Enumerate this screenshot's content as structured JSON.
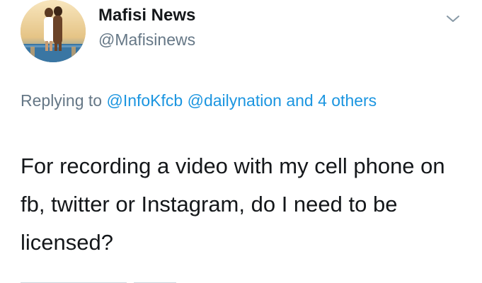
{
  "author": {
    "name": "Mafisi News",
    "handle": "@Mafisinews",
    "avatar_icon": "profile-photo"
  },
  "menu": {
    "icon": "chevron-down-icon"
  },
  "reply": {
    "prefix": "Replying to",
    "mentions": [
      "@InfoKfcb",
      "@dailynation"
    ],
    "connector": "and",
    "others_link": "4 others"
  },
  "tweet": {
    "text": "For recording a video with my cell phone on fb, twitter or Instagram, do I need to be licensed?"
  },
  "colors": {
    "link": "#1b95e0",
    "secondary": "#657786",
    "primary_text": "#14171a"
  }
}
